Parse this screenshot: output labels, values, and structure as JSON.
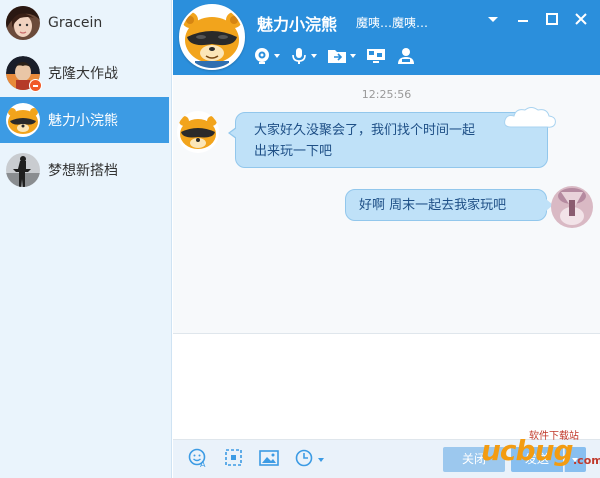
{
  "sidebar": {
    "contacts": [
      {
        "name": "Gracein",
        "active": false
      },
      {
        "name": "克隆大作战",
        "active": false
      },
      {
        "name": "魅力小浣熊",
        "active": true
      },
      {
        "name": "梦想新搭档",
        "active": false
      }
    ]
  },
  "header": {
    "contact_name": "魅力小浣熊",
    "status": "魔咦…魔咦…",
    "window_controls": [
      "chevron-down-icon",
      "minimize-icon",
      "maximize-icon",
      "close-icon"
    ],
    "toolbar": [
      "video-call-icon",
      "voice-call-icon",
      "file-transfer-icon",
      "remote-assist-icon",
      "group-icon"
    ],
    "background_color": "#2b8fdc"
  },
  "chat": {
    "timestamp": "12:25:56",
    "messages": [
      {
        "direction": "in",
        "text_line1": "大家好久没聚会了，我们找个时间一起",
        "text_line2": "出来玩一下吧"
      },
      {
        "direction": "out",
        "text": "好啊 周末一起去我家玩吧"
      }
    ],
    "bubble_color": "#bfe1f8"
  },
  "input": {
    "value": "",
    "toolbar": [
      "emoji-icon",
      "screenshot-icon",
      "image-icon",
      "history-icon"
    ],
    "close_label": "关闭",
    "send_label": "发送"
  },
  "watermark": {
    "logo": "ucbug",
    "text": "软件下载站",
    "suffix": ".com"
  }
}
